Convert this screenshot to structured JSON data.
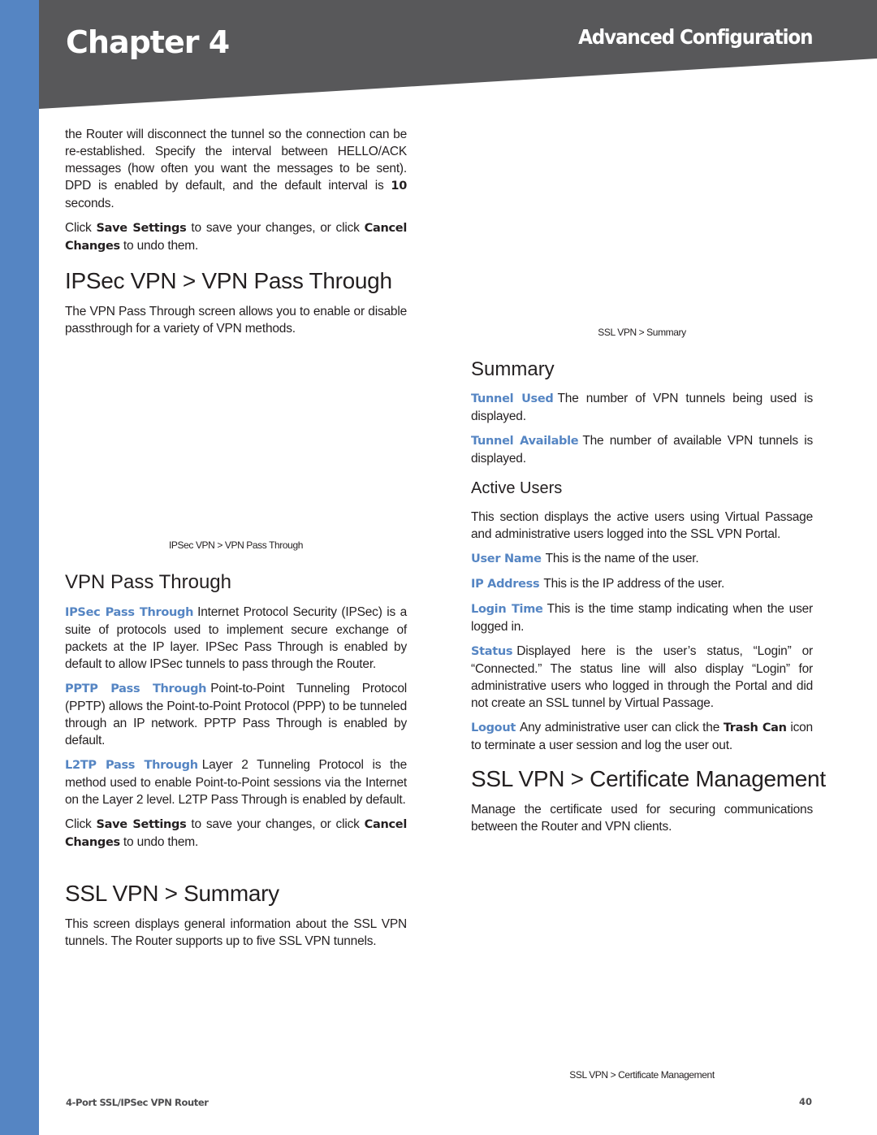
{
  "header": {
    "chapter": "Chapter 4",
    "section": "Advanced Configuration",
    "band_color": "#58585a",
    "strip_color": "#5585c3"
  },
  "left": {
    "intro_paragraph": "the Router will disconnect the tunnel so the connection can be re-established. Specify the interval between HELLO/ACK messages (how often you want the messages to be sent). DPD is enabled by default, and the default interval is ",
    "intro_bold_value": "10",
    "intro_tail": " seconds.",
    "save_note_1": {
      "pre": "Click ",
      "save": "Save Settings",
      "mid": " to save your changes, or click ",
      "cancel": "Cancel Changes",
      "post": " to undo them."
    },
    "heading_passthrough": "IPSec VPN > VPN Pass Through",
    "passthrough_desc": "The VPN Pass Through screen allows you to enable or disable passthrough for a variety of VPN methods.",
    "caption_passthrough": "IPSec VPN > VPN Pass Through",
    "subheading_passthrough": "VPN Pass Through",
    "items": [
      {
        "term": "IPSec Pass Through",
        "text": "Internet Protocol Security (IPSec) is a suite of protocols used to implement secure exchange of packets at the IP layer. IPSec Pass Through is enabled by default to allow IPSec tunnels to pass through the Router."
      },
      {
        "term": "PPTP Pass Through",
        "text": "Point-to-Point Tunneling Protocol (PPTP) allows the Point-to-Point Protocol (PPP) to be tunneled through an IP network. PPTP Pass Through is enabled by default."
      },
      {
        "term": "L2TP Pass Through",
        "text": "Layer 2 Tunneling Protocol is the method used to enable Point-to-Point sessions via the Internet on the Layer 2 level. L2TP Pass Through is enabled by default."
      }
    ],
    "save_note_2": {
      "pre": "Click ",
      "save": "Save Settings",
      "mid": " to save your changes, or click ",
      "cancel": "Cancel Changes",
      "post": " to undo them."
    },
    "heading_ssl_summary": "SSL VPN > Summary",
    "ssl_summary_desc": "This screen displays general information about the SSL VPN tunnels. The Router supports up to five SSL VPN tunnels."
  },
  "right": {
    "caption_summary": "SSL VPN > Summary",
    "subheading_summary": "Summary",
    "summary_items": [
      {
        "term": "Tunnel Used",
        "text": "The number of VPN tunnels being used is displayed."
      },
      {
        "term": "Tunnel Available",
        "text": "The number of available VPN tunnels is displayed."
      }
    ],
    "subheading_active_users": "Active Users",
    "active_users_desc": "This section displays the active users using Virtual Passage and administrative users logged into the SSL VPN Portal.",
    "user_items": [
      {
        "term": "User Name",
        "text": "This is the name of the user."
      },
      {
        "term": "IP Address",
        "text": "This is the IP address of the user."
      },
      {
        "term": "Login Time",
        "text": "This is the time stamp indicating when the user logged in."
      },
      {
        "term": "Status",
        "text": "Displayed here is the user’s status, “Login” or “Connected.” The status line will also display “Login” for administrative users who logged in through the Portal and did not create an SSL tunnel by Virtual Passage."
      }
    ],
    "logout_item": {
      "term": "Logout",
      "pre": "Any administrative user can click the ",
      "bold": "Trash Can",
      "post": " icon to terminate a user session and log the user out."
    },
    "heading_cert": "SSL VPN > Certificate Management",
    "cert_desc": "Manage the certificate used for securing communications between the Router and VPN clients.",
    "caption_cert": "SSL VPN > Certificate Management"
  },
  "footer": {
    "product": "4-Port SSL/IPSec VPN Router",
    "page_number": "40"
  }
}
